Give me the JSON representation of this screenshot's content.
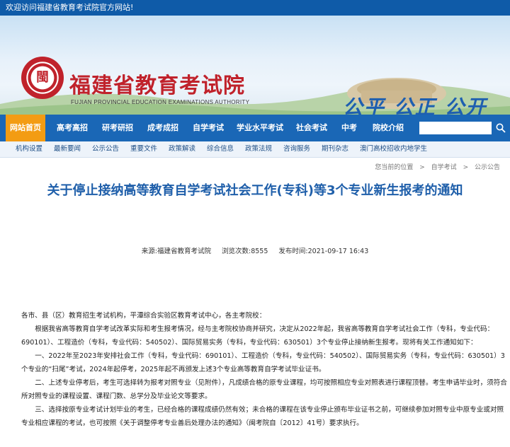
{
  "topbar": {
    "welcome": "欢迎访问福建省教育考试院官方网站!"
  },
  "header": {
    "seal_glyph": "閩",
    "org_name_cn": "福建省教育考试院",
    "org_name_en": "FUJIAN PROVINCIAL EDUCATION EXAMINATIONS AUTHORITY",
    "motto": "公平 公正 公开"
  },
  "nav": {
    "items": [
      "网站首页",
      "高考高招",
      "研考研招",
      "成考成招",
      "自学考试",
      "学业水平考试",
      "社会考试",
      "中考",
      "院校介绍"
    ],
    "active_index": 0,
    "search_placeholder": ""
  },
  "subnav": {
    "items": [
      "机构设置",
      "最新要闻",
      "公示公告",
      "重要文件",
      "政策解读",
      "综合信息",
      "政策法规",
      "咨询服务",
      "期刊杂志",
      "澳门高校招收内地学生"
    ]
  },
  "breadcrumb": {
    "home": "您当前的位置",
    "sep1": ">",
    "cat": "自学考试",
    "sep2": ">",
    "sub": "公示公告"
  },
  "article": {
    "title": "关于停止接纳高等教育自学考试社会工作(专科)等3个专业新生报考的通知",
    "source_label": "来源:",
    "source": "福建省教育考试院",
    "views_label": "浏览次数:",
    "views": "8555",
    "time_label": "发布时间:",
    "time": "2021-09-17 16:43",
    "salutation": "各市、县（区）教育招生考试机构，平潭综合实验区教育考试中心，各主考院校：",
    "p1": "根据我省高等教育自学考试改革实际和考生报考情况，经与主考院校协商并研究，决定从2022年起，我省高等教育自学考试社会工作（专科，专业代码：690101）、工程造价（专科，专业代码：540502）、国际贸易实务（专科，专业代码：630501）3个专业停止接纳新生报考。现将有关工作通知如下：",
    "p2": "一、2022年至2023年安排社会工作（专科，专业代码：690101）、工程造价（专科，专业代码：540502）、国际贸易实务（专科，专业代码：630501）3个专业的“扫尾”考试，2024年起停考，2025年起不再颁发上述3个专业高等教育自学考试毕业证书。",
    "p3": "二、上述专业停考后，考生可选择转为报考对照专业（见附件），凡成绩合格的原专业课程，均可按照相应专业对照表进行课程顶替。考生申请毕业时，须符合所对照专业的课程设置、课程门数、总学分及毕业论文等要求。",
    "p4": "三、选择按原专业考试计划毕业的考生，已经合格的课程成绩仍然有效；未合格的课程在该专业停止颁布毕业证书之前，可继续参加对照专业中原专业或对照专业相应课程的考试，也可按照《关于调整停考专业善后处理办法的通知》（闽考院自〔2012〕41号）要求执行。"
  },
  "colors": {
    "brand_blue": "#1a67b6",
    "active_orange": "#f39c13",
    "title_blue": "#1f5faa",
    "seal_red": "#c0222b"
  }
}
